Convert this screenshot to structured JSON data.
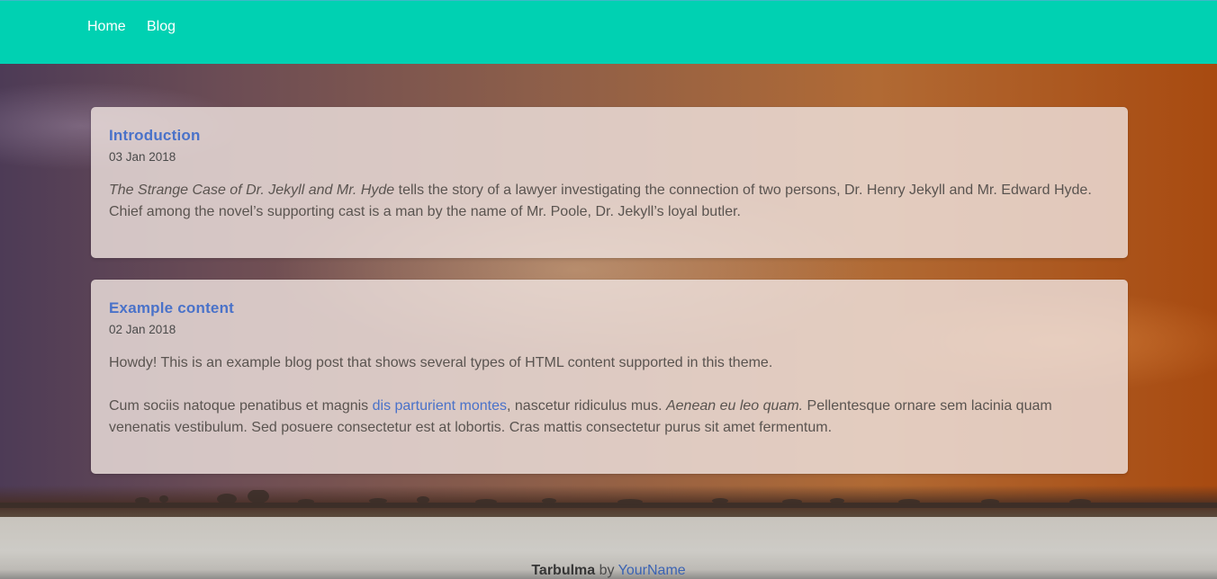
{
  "nav": {
    "items": [
      {
        "label": "Home"
      },
      {
        "label": "Blog"
      }
    ]
  },
  "posts": [
    {
      "title": "Introduction",
      "date": "03 Jan 2018",
      "paragraphs": [
        {
          "em": "The Strange Case of Dr. Jekyll and Mr. Hyde",
          "text": " tells the story of a lawyer investigating the connection of two persons, Dr. Henry Jekyll and Mr. Edward Hyde. Chief among the novel’s supporting cast is a man by the name of Mr. Poole, Dr. Jekyll’s loyal butler."
        }
      ]
    },
    {
      "title": "Example content",
      "date": "02 Jan 2018",
      "paragraphs": [
        {
          "text": "Howdy! This is an example blog post that shows several types of HTML content supported in this theme."
        },
        {
          "text_before_link": "Cum sociis natoque penatibus et magnis ",
          "link": "dis parturient montes",
          "text_after_link": ", nascetur ridiculus mus. ",
          "em": "Aenean eu leo quam.",
          "text_end": " Pellentesque ornare sem lacinia quam venenatis vestibulum. Sed posuere consectetur est at lobortis. Cras mattis consectetur purus sit amet fermentum."
        }
      ]
    }
  ],
  "footer": {
    "brand": "Tarbulma",
    "by": " by ",
    "author_link": "YourName"
  },
  "colors": {
    "navbar": "#00d1b2",
    "link": "#4a72c9"
  }
}
